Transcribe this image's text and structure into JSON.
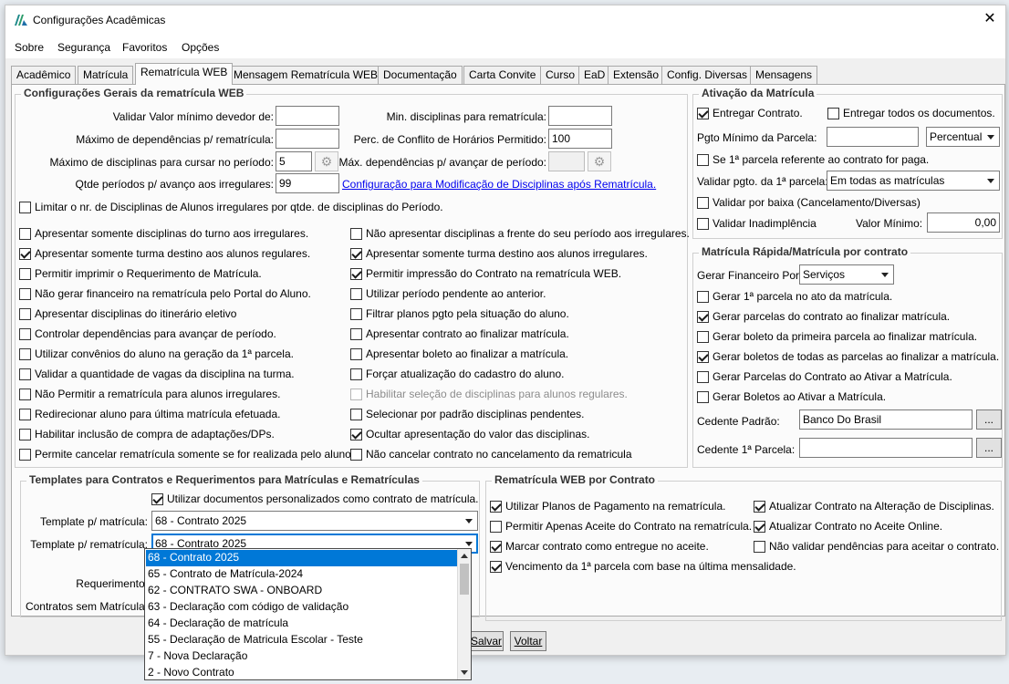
{
  "window": {
    "title": "Configurações Acadêmicas"
  },
  "menu": [
    "Sobre",
    "Segurança",
    "Favoritos",
    "Opções"
  ],
  "tabs": [
    "Acadêmico",
    "Matrícula",
    "Rematrícula WEB",
    "Mensagem Rematrícula WEB",
    "Documentação",
    "Carta Convite",
    "Curso",
    "EaD",
    "Extensão",
    "Config. Diversas",
    "Mensagens"
  ],
  "active_tab": "Rematrícula WEB",
  "geral": {
    "title": "Configurações Gerais da rematrícula WEB",
    "validar_valor_label": "Validar Valor mínimo devedor de:",
    "validar_valor_value": "",
    "max_dep_label": "Máximo de dependências p/ rematrícula:",
    "max_dep_value": "",
    "max_disc_label": "Máximo de disciplinas para cursar no período:",
    "max_disc_value": "5",
    "qtde_label": "Qtde períodos p/ avanço aos irregulares:",
    "qtde_value": "99",
    "min_disc_label": "Min. disciplinas para rematrícula:",
    "min_disc_value": "",
    "perc_label": "Perc. de Conflito de Horários Permitido:",
    "perc_value": "100",
    "max_dep_avanco_label": "Máx. dependências p/ avançar de período:",
    "max_dep_avanco_value": "",
    "link": "Configuração para Modificação de Disciplinas após Rematrícula.",
    "limitar_label": "Limitar o nr. de Disciplinas de Alunos irregulares por qtde. de disciplinas do Período.",
    "limitar_checked": false,
    "left_checks": [
      {
        "label": "Apresentar somente disciplinas do turno aos irregulares.",
        "checked": false
      },
      {
        "label": "Apresentar somente turma destino aos alunos regulares.",
        "checked": true
      },
      {
        "label": "Permitir imprimir o Requerimento de Matrícula.",
        "checked": false
      },
      {
        "label": "Não gerar financeiro na rematrícula pelo Portal do Aluno.",
        "checked": false
      },
      {
        "label": "Apresentar disciplinas do itinerário eletivo",
        "checked": false
      },
      {
        "label": "Controlar dependências para avançar de período.",
        "checked": false
      },
      {
        "label": "Utilizar convênios do aluno na geração da 1ª parcela.",
        "checked": false
      },
      {
        "label": "Validar a quantidade de vagas da disciplina na turma.",
        "checked": false
      },
      {
        "label": "Não Permitir a rematrícula para alunos irregulares.",
        "checked": false
      },
      {
        "label": "Redirecionar aluno para última matrícula efetuada.",
        "checked": false
      },
      {
        "label": "Habilitar inclusão de compra de adaptações/DPs.",
        "checked": false
      },
      {
        "label": "Permite cancelar rematrícula somente se for realizada pelo aluno.",
        "checked": false
      }
    ],
    "right_checks": [
      {
        "label": "Não apresentar disciplinas a frente do seu período aos irregulares.",
        "checked": false,
        "disabled": false
      },
      {
        "label": "Apresentar somente turma destino aos alunos irregulares.",
        "checked": true,
        "disabled": false
      },
      {
        "label": "Permitir impressão do Contrato na rematrícula WEB.",
        "checked": true,
        "disabled": false
      },
      {
        "label": "Utilizar período pendente ao anterior.",
        "checked": false,
        "disabled": false
      },
      {
        "label": "Filtrar planos pgto pela situação do aluno.",
        "checked": false,
        "disabled": false
      },
      {
        "label": "Apresentar contrato ao finalizar matrícula.",
        "checked": false,
        "disabled": false
      },
      {
        "label": "Apresentar boleto ao finalizar a matrícula.",
        "checked": false,
        "disabled": false
      },
      {
        "label": "Forçar atualização do cadastro do aluno.",
        "checked": false,
        "disabled": false
      },
      {
        "label": "Habilitar seleção de disciplinas para alunos regulares.",
        "checked": false,
        "disabled": true
      },
      {
        "label": "Selecionar por padrão disciplinas pendentes.",
        "checked": false,
        "disabled": false
      },
      {
        "label": "Ocultar apresentação do valor das disciplinas.",
        "checked": true,
        "disabled": false
      },
      {
        "label": "Não cancelar contrato no cancelamento da rematricula",
        "checked": false,
        "disabled": false
      }
    ]
  },
  "ativacao": {
    "title": "Ativação da Matrícula",
    "entregar_contrato": {
      "label": "Entregar Contrato.",
      "checked": true
    },
    "entregar_todos": {
      "label": "Entregar todos os documentos.",
      "checked": false
    },
    "pgto_min_label": "Pgto Mínimo da Parcela:",
    "pgto_min_value": "",
    "pgto_tipo": "Percentual",
    "se_primeira": {
      "label": "Se 1ª parcela referente ao contrato for paga.",
      "checked": false
    },
    "validar_pgto_label": "Validar pgto. da 1ª parcela:",
    "validar_pgto_value": "Em todas as matrículas",
    "validar_baixa": {
      "label": "Validar por baixa (Cancelamento/Diversas)",
      "checked": false
    },
    "validar_inad": {
      "label": "Validar Inadimplência",
      "checked": false
    },
    "valor_minimo_label": "Valor Mínimo:",
    "valor_minimo_value": "0,00"
  },
  "rapida": {
    "title": "Matrícula Rápida/Matrícula por contrato",
    "gerar_fin_label": "Gerar Financeiro Por:",
    "gerar_fin_value": "Serviços",
    "checks": [
      {
        "label": "Gerar 1ª parcela no ato da matrícula.",
        "checked": false
      },
      {
        "label": "Gerar parcelas do contrato ao finalizar matrícula.",
        "checked": true
      },
      {
        "label": "Gerar boleto da primeira parcela ao finalizar matrícula.",
        "checked": false
      },
      {
        "label": "Gerar boletos de todas as parcelas ao finalizar a matrícula.",
        "checked": true
      },
      {
        "label": "Gerar Parcelas do Contrato ao Ativar a Matrícula.",
        "checked": false
      },
      {
        "label": "Gerar Boletos ao Ativar a Matrícula.",
        "checked": false
      }
    ],
    "cedente_padrao_label": "Cedente Padrão:",
    "cedente_padrao_value": "Banco Do Brasil",
    "cedente_parcela_label": "Cedente 1ª Parcela:",
    "cedente_parcela_value": "",
    "ellipsis": "..."
  },
  "templates": {
    "title": "Templates para Contratos e Requerimentos para Matrículas e Rematrículas",
    "utilizar": {
      "label": "Utilizar documentos personalizados como contrato de matrícula.",
      "checked": true
    },
    "tpl_matricula_label": "Template p/ matrícula:",
    "tpl_matricula_value": "68 - Contrato 2025",
    "tpl_rematricula_label": "Template p/ rematrícula:",
    "tpl_rematricula_value": "68 - Contrato 2025",
    "requerimento_label": "Requerimento:",
    "contratos_sem_label": "Contratos sem Matrícula:"
  },
  "dropdown": {
    "items": [
      "68 - Contrato 2025",
      "65 - Contrato de Matrícula-2024",
      "62 - CONTRATO SWA - ONBOARD",
      "63 - Declaração com código de validação",
      "64 - Declaração de matrícula",
      "55 - Declaração de Matricula Escolar - Teste",
      "7 - Nova Declaração",
      "2 - Novo Contrato"
    ],
    "selected": 0
  },
  "web_contrato": {
    "title": "Rematrícula WEB por Contrato",
    "checks": [
      {
        "label": "Utilizar Planos de Pagamento na rematrícula.",
        "checked": true
      },
      {
        "label": "Atualizar Contrato na Alteração de Disciplinas.",
        "checked": true
      },
      {
        "label": "Permitir Apenas Aceite do Contrato na rematrícula.",
        "checked": false
      },
      {
        "label": "Atualizar Contrato no Aceite Online.",
        "checked": true
      },
      {
        "label": "Marcar contrato como entregue no aceite.",
        "checked": true
      },
      {
        "label": "Não validar pendências para aceitar o contrato.",
        "checked": false
      },
      {
        "label": "Vencimento da 1ª parcela com base na última mensalidade.",
        "checked": true
      }
    ]
  },
  "buttons": {
    "salvar": "Salvar",
    "voltar": "Voltar"
  }
}
